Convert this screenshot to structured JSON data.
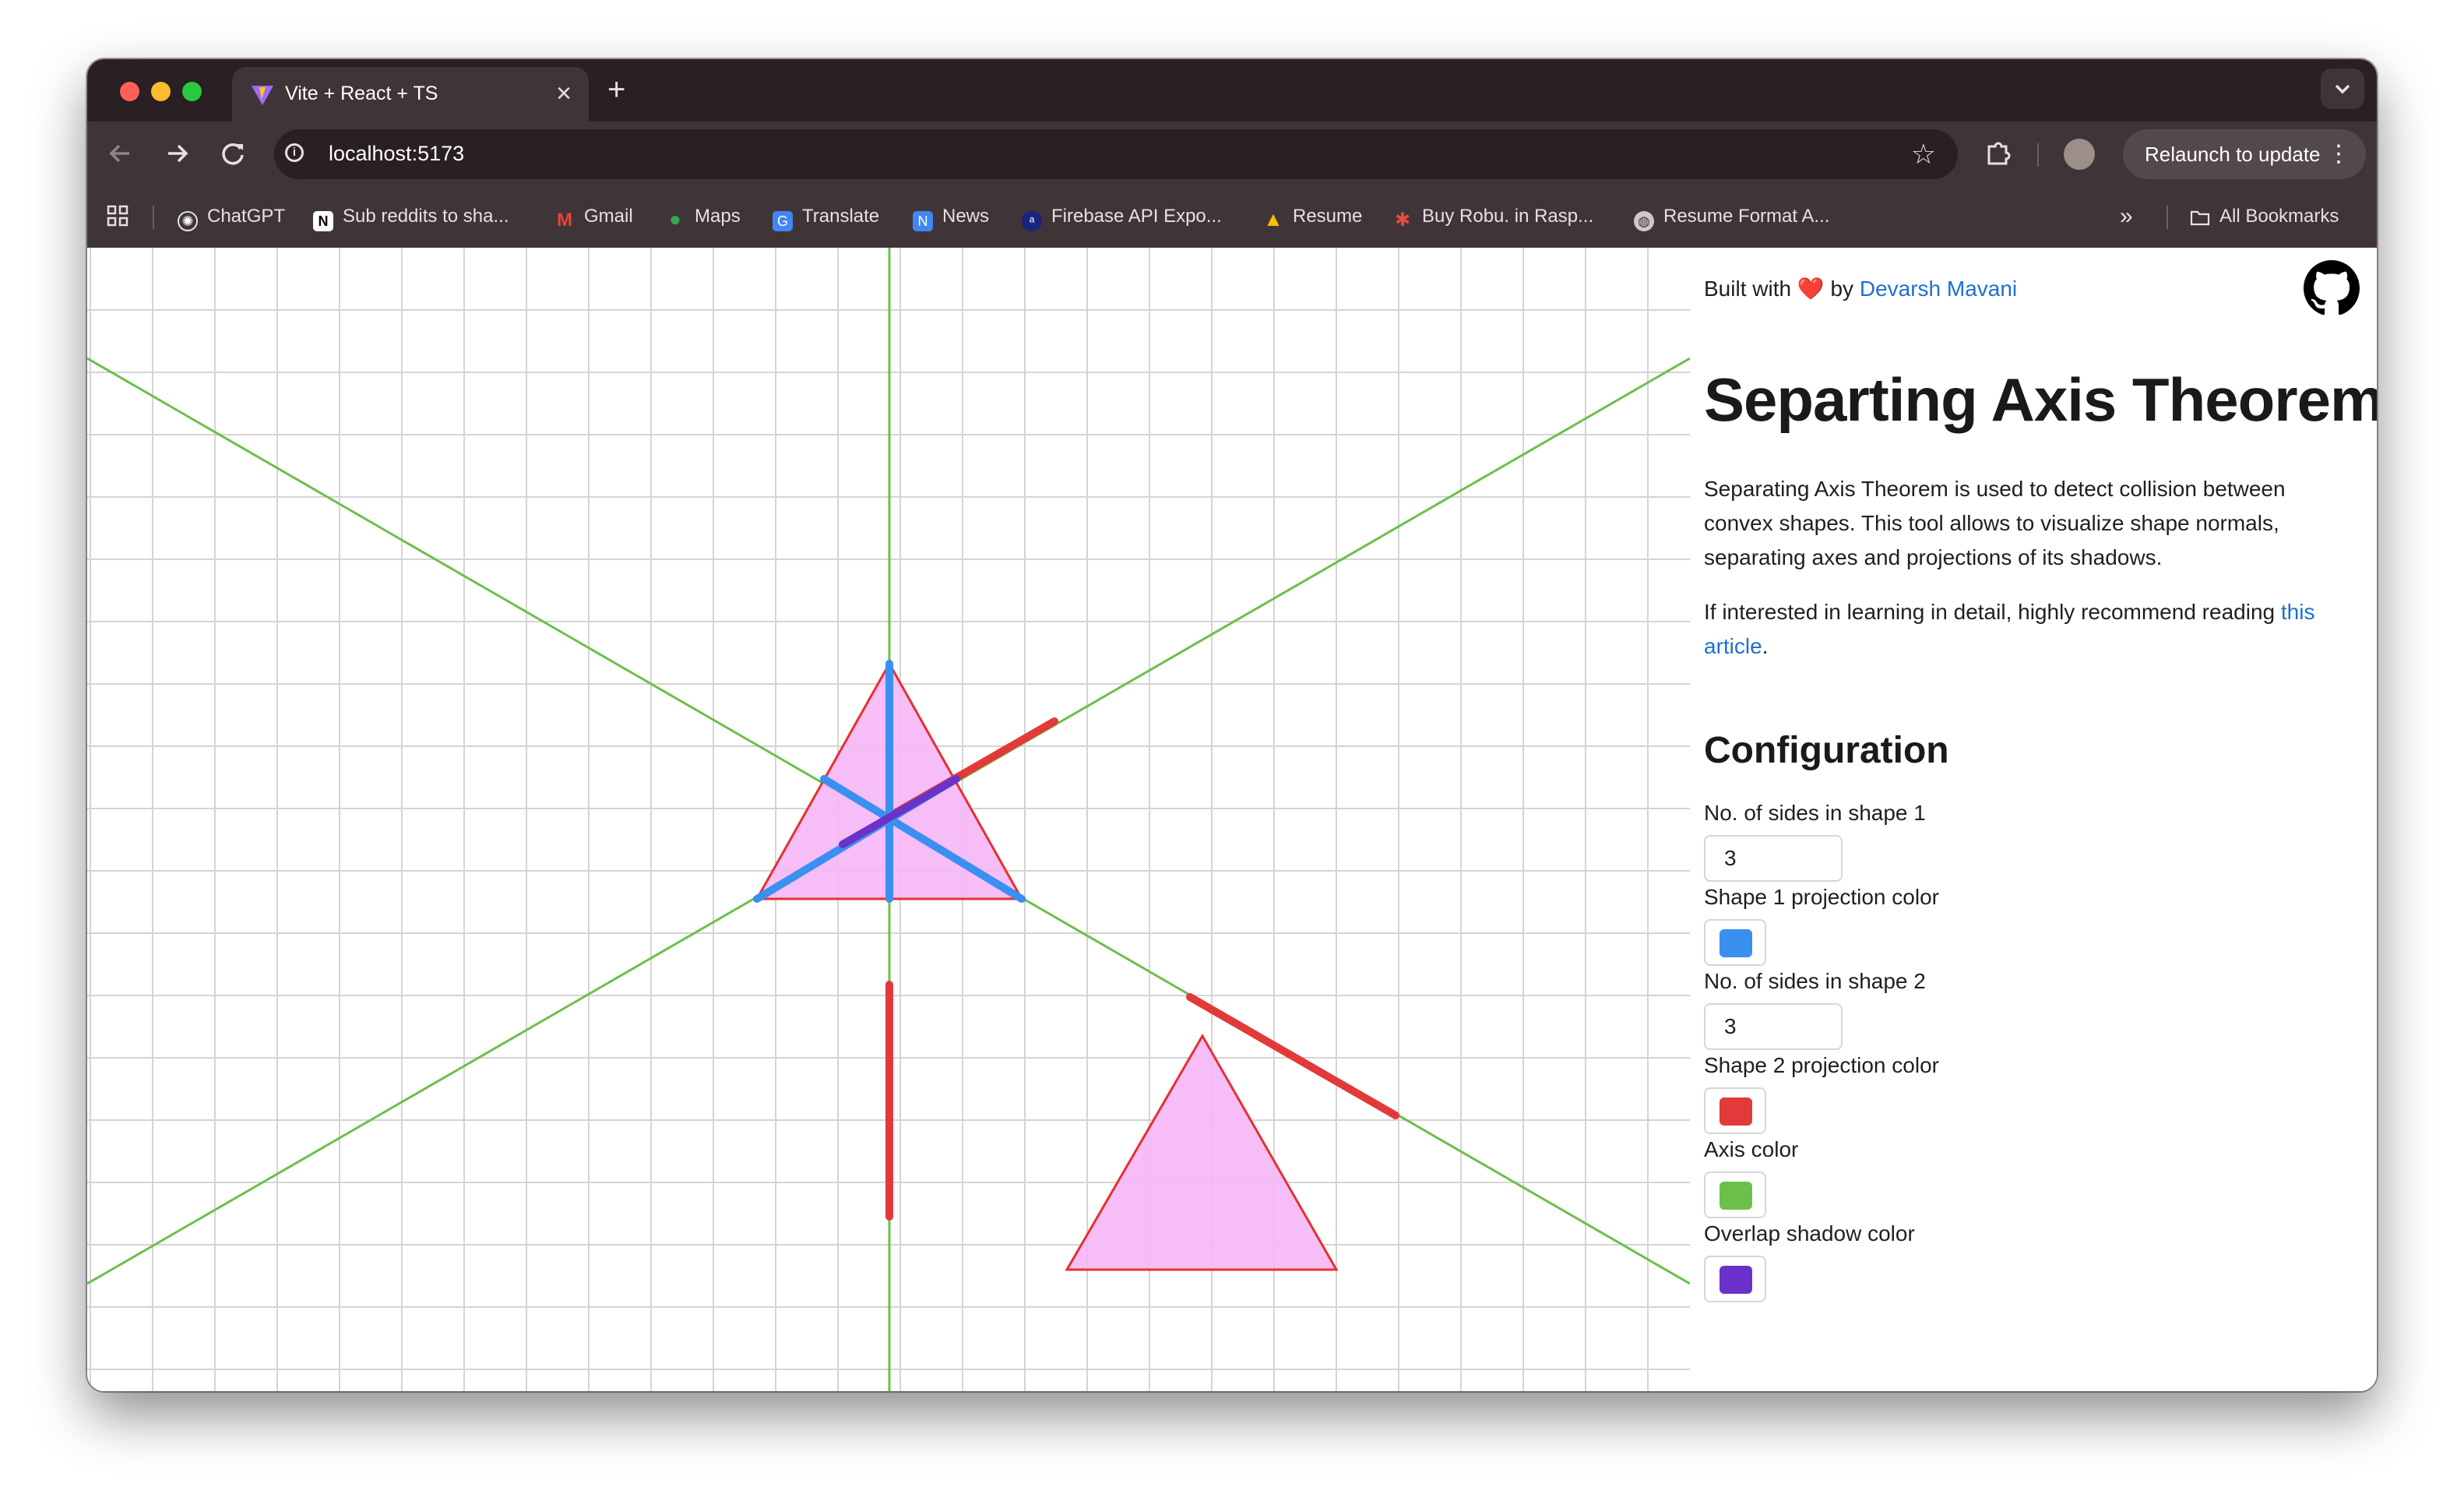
{
  "browser": {
    "tab_title": "Vite + React + TS",
    "tab_close": "×",
    "new_tab": "+",
    "url": "localhost:5173",
    "relaunch_label": "Relaunch to update",
    "bookmarks": [
      {
        "label": "ChatGPT",
        "icon": "chatgpt-icon"
      },
      {
        "label": "Sub reddits to sha...",
        "icon": "notion-icon"
      },
      {
        "label": "Gmail",
        "icon": "gmail-icon"
      },
      {
        "label": "Maps",
        "icon": "maps-icon"
      },
      {
        "label": "Translate",
        "icon": "translate-icon"
      },
      {
        "label": "News",
        "icon": "news-icon"
      },
      {
        "label": "Firebase API Expo...",
        "icon": "firebase-icon"
      },
      {
        "label": "Resume",
        "icon": "drive-icon"
      },
      {
        "label": "Buy Robu. in Rasp...",
        "icon": "robu-icon"
      },
      {
        "label": "Resume Format A...",
        "icon": "globe-icon"
      }
    ],
    "more_bookmarks": "»",
    "all_bookmarks": "All Bookmarks"
  },
  "sidebar": {
    "built_prefix": "Built with",
    "heart": "❤️",
    "built_by": "by",
    "author": "Devarsh Mavani",
    "title": "Separting Axis Theorem",
    "description": "Separating Axis Theorem is used to detect collision between convex shapes. This tool allows to visualize shape normals, separating axes and projections of its shadows.",
    "reading_prefix": "If interested in learning in detail, highly recommend reading",
    "reading_link": "this article",
    "reading_suffix": ".",
    "config_heading": "Configuration"
  },
  "config": {
    "shape1_sides_label": "No. of sides in shape 1",
    "shape1_sides_value": "3",
    "shape1_color_label": "Shape 1 projection color",
    "shape1_color": "#3b8ff0",
    "shape2_sides_label": "No. of sides in shape 2",
    "shape2_sides_value": "3",
    "shape2_color_label": "Shape 2 projection color",
    "shape2_color": "#e23a3a",
    "axis_color_label": "Axis color",
    "axis_color": "#6cc04a",
    "overlap_color_label": "Overlap shadow color",
    "overlap_color": "#6a32c8"
  },
  "colors": {
    "shape_fill": "#f5b6f5",
    "shape_stroke": "#e53030",
    "grid": "#d4d4d4"
  }
}
